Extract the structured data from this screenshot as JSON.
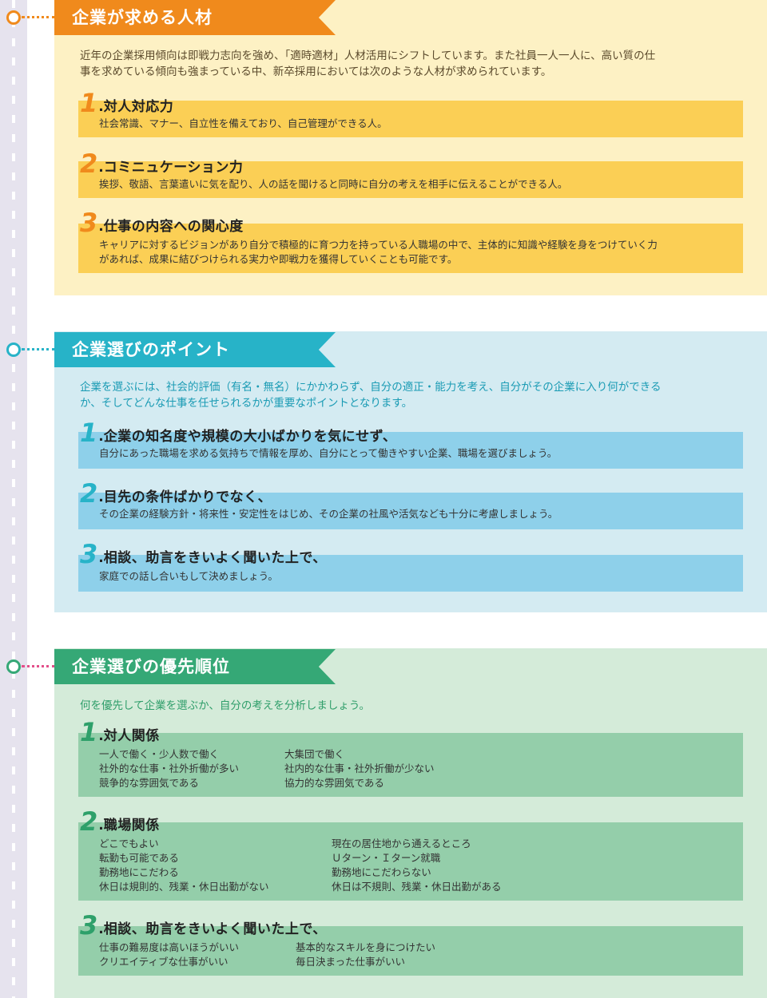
{
  "sections": [
    {
      "title": "企業が求める人材",
      "intro_lines": [
        "近年の企業採用傾向は即戦力志向を強め、「適時適材」人材活用にシフトしています。また社員一人一人に、高い質の仕",
        "事を求めている傾向も強まっている中、新卒採用においては次のような人材が求められています。"
      ],
      "items": [
        {
          "num": "1",
          "title": "対人対応力",
          "desc": [
            "社会常識、マナー、自立性を備えており、自己管理ができる人。"
          ]
        },
        {
          "num": "2",
          "title": "コミニュケーション力",
          "desc": [
            "挨拶、敬語、言葉遣いに気を配り、人の話を聞けると同時に自分の考えを相手に伝えることができる人。"
          ]
        },
        {
          "num": "3",
          "title": "仕事の内容への関心度",
          "desc": [
            "キャリアに対するビジョンがあり自分で積極的に育つ力を持っている人職場の中で、主体的に知識や経験を身をつけていく力",
            "があれば、成果に結びつけられる実力や即戦力を獲得していくことも可能です。"
          ]
        }
      ]
    },
    {
      "title": "企業選びのポイント",
      "intro_lines": [
        "企業を選ぶには、社会的評価（有名・無名）にかかわらず、自分の適正・能力を考え、自分がその企業に入り何ができる",
        "か、そしてどんな仕事を任せられるかが重要なポイントとなります。"
      ],
      "items": [
        {
          "num": "1",
          "title": "企業の知名度や規模の大小ばかりを気にせず、",
          "desc": [
            "自分にあった職場を求める気持ちで情報を厚め、自分にとって働きやすい企業、職場を選びましょう。"
          ]
        },
        {
          "num": "2",
          "title": "目先の条件ばかりでなく、",
          "desc": [
            "その企業の経験方針・将来性・安定性をはじめ、その企業の社風や活気なども十分に考慮しましょう。"
          ]
        },
        {
          "num": "3",
          "title": "相談、助言をきいよく聞いた上で、",
          "desc": [
            "家庭での話し合いもして決めましょう。"
          ]
        }
      ]
    },
    {
      "title": "企業選びの優先順位",
      "intro_lines": [
        "何を優先して企業を選ぶか、自分の考えを分析しましょう。"
      ],
      "items": [
        {
          "num": "1",
          "title": "対人関係",
          "left": [
            "一人で働く・少人数で働く",
            "社外的な仕事・社外折働が多い",
            "競争的な雰囲気である"
          ],
          "right": [
            "大集団で働く",
            "社内的な仕事・社外折働が少ない",
            "協力的な雰囲気である"
          ]
        },
        {
          "num": "2",
          "title": "職場関係",
          "left": [
            "どこでもよい",
            "転勤も可能である",
            "勤務地にこだわる",
            "休日は規則的、残業・休日出勤がない"
          ],
          "right": [
            "現在の居住地から通えるところ",
            "Ｕターン・Ｉターン就職",
            "勤務地にこだわらない",
            "休日は不規則、残業・休日出勤がある"
          ]
        },
        {
          "num": "3",
          "title": "相談、助言をきいよく聞いた上で、",
          "left": [
            "仕事の難易度は高いほうがいい",
            "クリエイティブな仕事がいい"
          ],
          "right": [
            "基本的なスキルを身につけたい",
            "毎日決まった仕事がいい"
          ]
        }
      ]
    }
  ],
  "colors": {
    "orange": "#f08a1c",
    "blue": "#27b3c8",
    "green": "#35a876"
  }
}
